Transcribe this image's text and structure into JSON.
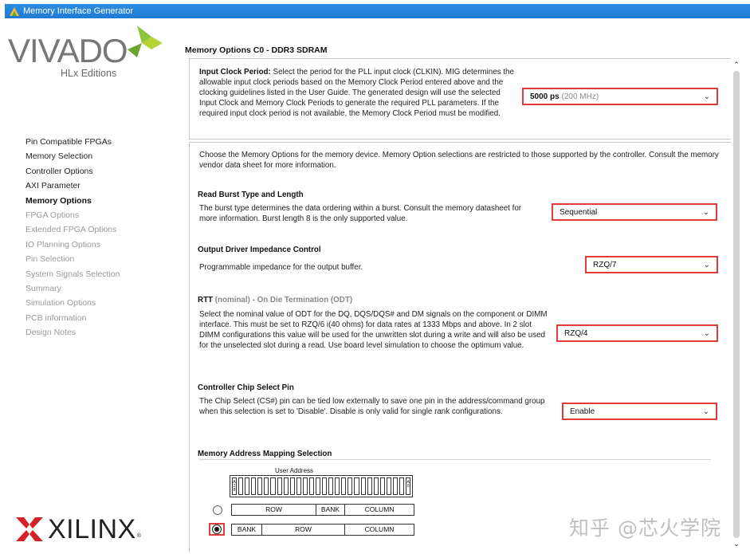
{
  "window": {
    "title": "Memory Interface Generator"
  },
  "sidebar": {
    "brand": "VIVADO",
    "edition": "HLx Editions",
    "vendor": "XILINX",
    "vendor_mark": "®",
    "items": [
      {
        "label": "Pin Compatible FPGAs",
        "state": "done"
      },
      {
        "label": "Memory Selection",
        "state": "done"
      },
      {
        "label": "Controller Options",
        "state": "done"
      },
      {
        "label": "AXI Parameter",
        "state": "done"
      },
      {
        "label": "Memory Options",
        "state": "active"
      },
      {
        "label": "FPGA Options",
        "state": "todo"
      },
      {
        "label": "Extended FPGA Options",
        "state": "todo"
      },
      {
        "label": "IO Planning Options",
        "state": "todo"
      },
      {
        "label": "Pin Selection",
        "state": "todo"
      },
      {
        "label": "System Signals Selection",
        "state": "todo"
      },
      {
        "label": "Summary",
        "state": "todo"
      },
      {
        "label": "Simulation Options",
        "state": "todo"
      },
      {
        "label": "PCB information",
        "state": "todo"
      },
      {
        "label": "Design Notes",
        "state": "todo"
      }
    ]
  },
  "main": {
    "title": "Memory Options C0 - DDR3 SDRAM",
    "clock": {
      "label": "Input Clock Period:",
      "desc": "Select the period for the PLL input clock (CLKIN). MIG determines the allowable input clock periods based on the Memory Clock Period entered above and the clocking guidelines listed in the User Guide. The generated design will use the selected Input Clock and Memory Clock Periods to generate the required PLL parameters. If the required input clock period is not available, the Memory Clock Period must be modified.",
      "value": "5000 ps",
      "value_sub": "(200 MHz)"
    },
    "intro": "Choose the Memory Options for the memory device. Memory Option selections are restricted to those supported by the controller. Consult the memory vendor data sheet for more information.",
    "burst": {
      "heading": "Read Burst Type and Length",
      "desc": "The burst type determines the data ordering within a burst. Consult the memory datasheet for more information. Burst length 8 is the only supported value.",
      "value": "Sequential"
    },
    "odi": {
      "heading": "Output Driver Impedance Control",
      "desc": "Programmable impedance for the output buffer.",
      "value": "RZQ/7"
    },
    "rtt": {
      "heading": "RTT",
      "heading_muted": "(nominal) - On Die Termination (ODT)",
      "desc": "Select the nominal value of ODT for the DQ, DQS/DQS# and DM signals on the component or DIMM interface. This must be set to RZQ/6 i(40 ohms) for data rates at 1333 Mbps and above. In 2 slot DIMM configurations this value will be used for the unwritten slot during a write and will also be used for the unselected slot during a read. Use board level simulation to choose the optimum value.",
      "value": "RZQ/4"
    },
    "cs": {
      "heading": "Controller Chip Select Pin",
      "desc": "The Chip Select (CS#) pin can be tied low externally to save one pin in the address/command group when this selection is set to 'Disable'. Disable is only valid for single rank configurations.",
      "value": "Enable"
    },
    "mapping": {
      "heading": "Memory Address Mapping Selection",
      "user_address": "User Address",
      "msb_label": "A 2 8",
      "lsb_label": "A 0",
      "option1": [
        "ROW",
        "BANK",
        "COLUMN"
      ],
      "option2": [
        "BANK",
        "ROW",
        "COLUMN"
      ],
      "selected": 2
    }
  },
  "watermark": "知乎 @芯火学院",
  "colors": {
    "titlebar": "#1f7bd2",
    "highlight": "#e03a3a",
    "logo_green": "#a5c739"
  }
}
